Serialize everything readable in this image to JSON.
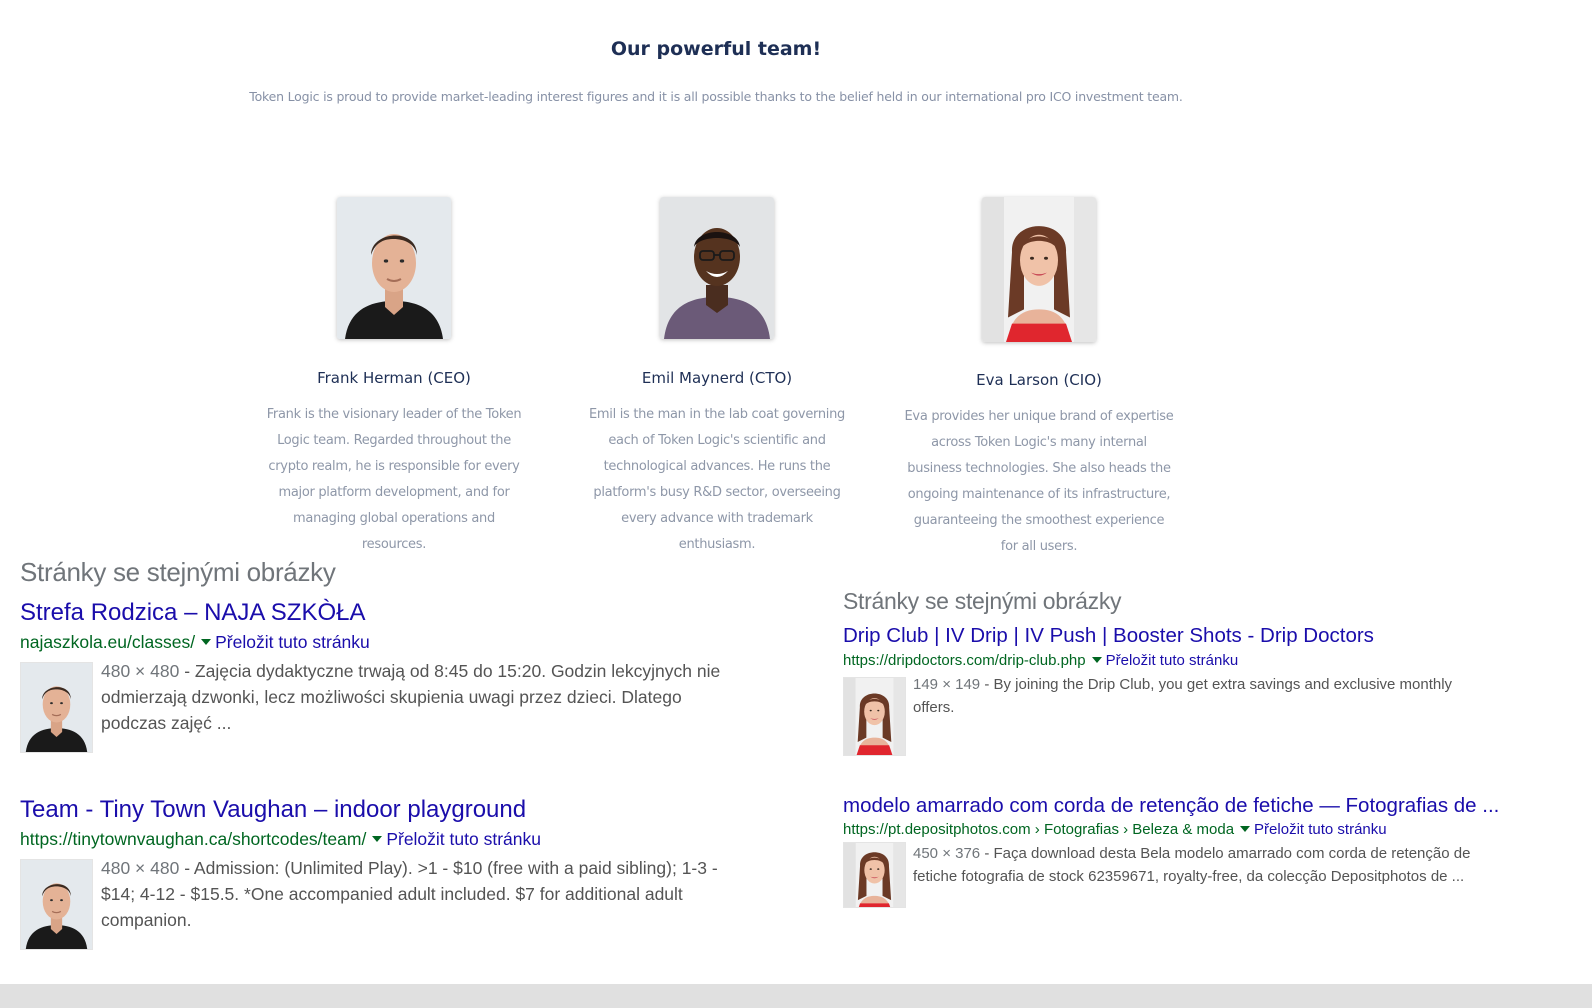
{
  "team": {
    "title": "Our powerful team!",
    "subtitle": "Token Logic is proud to provide market-leading interest figures and it is all possible thanks to the belief held in our international pro ICO investment team.",
    "members": [
      {
        "name": "Frank Herman (CEO)",
        "desc": "Frank is the visionary leader of the Token Logic team. Regarded throughout the crypto realm, he is responsible for every major platform development, and for managing global operations and resources."
      },
      {
        "name": "Emil Maynerd (CTO)",
        "desc": "Emil is the man in the lab coat governing each of Token Logic's scientific and technological advances. He runs the platform's busy R&D sector, overseeing every advance with trademark enthusiasm."
      },
      {
        "name": "Eva Larson (CIO)",
        "desc": "Eva provides her unique brand of expertise across Token Logic's many internal business technologies. She also heads the ongoing maintenance of its infrastructure, guaranteeing the smoothest experience for all users."
      }
    ]
  },
  "left": {
    "heading": "Stránky se stejnými obrázky",
    "results": [
      {
        "title": "Strefa Rodzica – NAJA SZKÒŁA",
        "url": "najaszkola.eu/classes/",
        "translate": "Přeložit tuto stránku",
        "dims": "480 × 480",
        "snippet": " - Zajęcia dydaktyczne trwają od 8:45 do 15:20. Godzin lekcyjnych nie odmierzają dzwonki, lecz możliwości skupienia uwagi przez dzieci. Dlatego podczas zajęć ..."
      },
      {
        "title": "Team - Tiny Town Vaughan – indoor playground",
        "url": "https://tinytownvaughan.ca/shortcodes/team/",
        "translate": "Přeložit tuto stránku",
        "dims": "480 × 480",
        "snippet": " - Admission: (Unlimited Play). >1 - $10 (free with a paid sibling); 1-3 - $14; 4-12 - $15.5. *One accompanied adult included. $7 for additional adult companion."
      }
    ]
  },
  "right": {
    "heading": "Stránky se stejnými obrázky",
    "results": [
      {
        "title": "Drip Club | IV Drip | IV Push | Booster Shots - Drip Doctors",
        "url": "https://dripdoctors.com/drip-club.php",
        "translate": "Přeložit tuto stránku",
        "dims": "149 × 149",
        "snippet": " - By joining the Drip Club, you get extra savings and exclusive monthly offers."
      },
      {
        "title": "modelo amarrado com corda de retenção de fetiche — Fotografias de ...",
        "url": "https://pt.depositphotos.com › Fotografias › Beleza & moda",
        "translate": "Přeložit tuto stránku",
        "dims": "450 × 376",
        "snippet": " - Faça download desta Bela modelo amarrado com corda de retenção de fetiche fotografia de stock 62359671, royalty-free, da colecção Depositphotos de ..."
      }
    ]
  },
  "colors": {
    "link": "#1a0dab",
    "url": "#006621",
    "team_title": "#1e2f55",
    "heading_gray": "#70757a"
  }
}
